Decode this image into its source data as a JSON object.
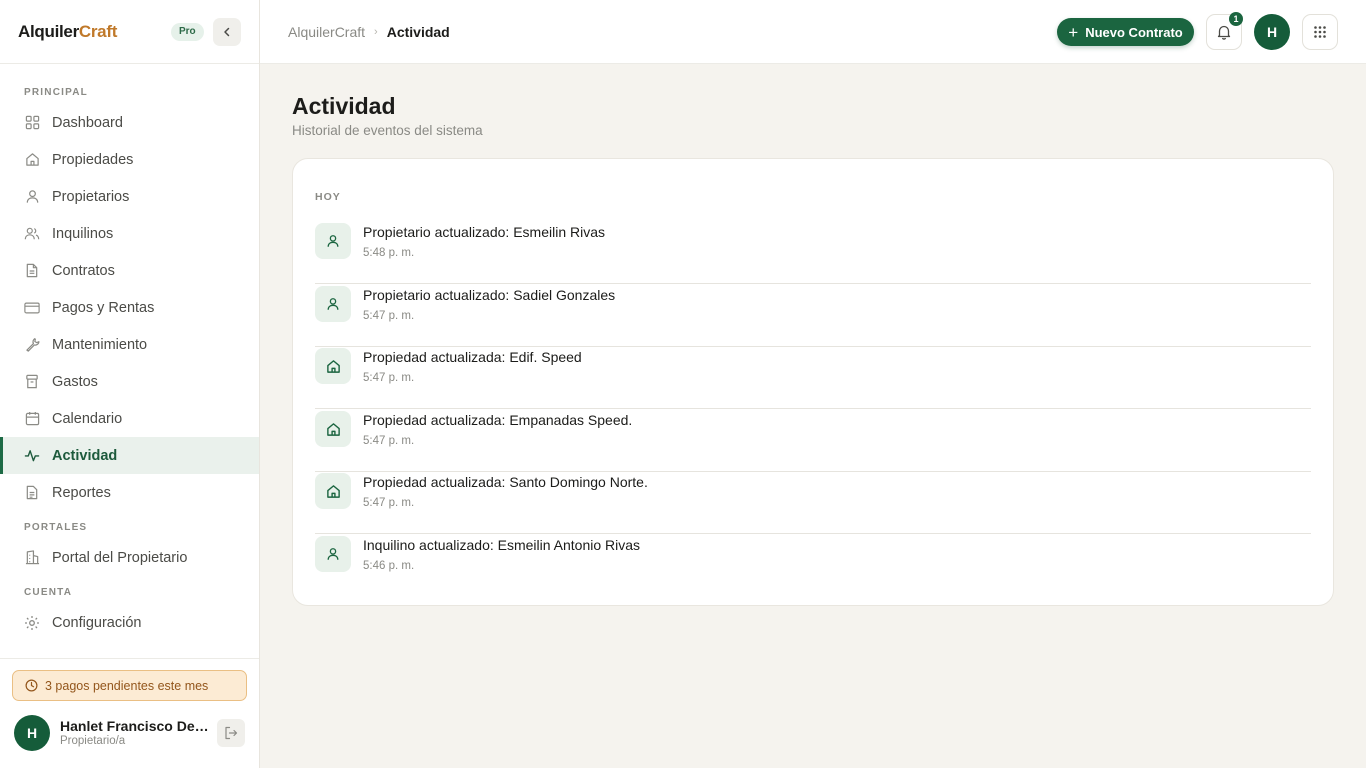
{
  "brand": {
    "part1": "Alquiler",
    "part2": "Craft",
    "badge": "Pro"
  },
  "sidebar": {
    "section_principal": "PRINCIPAL",
    "section_portales": "PORTALES",
    "section_cuenta": "CUENTA",
    "items": [
      {
        "label": "Dashboard",
        "icon": "grid-icon"
      },
      {
        "label": "Propiedades",
        "icon": "house-icon"
      },
      {
        "label": "Propietarios",
        "icon": "user-icon"
      },
      {
        "label": "Inquilinos",
        "icon": "users-icon"
      },
      {
        "label": "Contratos",
        "icon": "document-icon"
      },
      {
        "label": "Pagos y Rentas",
        "icon": "credit-card-icon"
      },
      {
        "label": "Mantenimiento",
        "icon": "wrench-icon"
      },
      {
        "label": "Gastos",
        "icon": "archive-icon"
      },
      {
        "label": "Calendario",
        "icon": "calendar-icon"
      },
      {
        "label": "Actividad",
        "icon": "activity-icon",
        "active": true
      },
      {
        "label": "Reportes",
        "icon": "report-icon"
      },
      {
        "label": "Portal del Propietario",
        "icon": "building-icon"
      },
      {
        "label": "Configuración",
        "icon": "gear-icon"
      }
    ],
    "pending": "3 pagos pendientes este mes",
    "user": {
      "initial": "H",
      "name": "Hanlet Francisco De L...",
      "role": "Propietario/a"
    }
  },
  "header": {
    "breadcrumb_root": "AlquilerCraft",
    "breadcrumb_sep": "›",
    "breadcrumb_current": "Actividad",
    "new_contract": "Nuevo Contrato",
    "notification_count": "1",
    "avatar_initial": "H"
  },
  "main": {
    "title": "Actividad",
    "subtitle": "Historial de eventos del sistema",
    "group": "HOY",
    "events": [
      {
        "title": "Propietario actualizado: Esmeilin Rivas",
        "time": "5:48 p. m.",
        "icon": "user-icon"
      },
      {
        "title": "Propietario actualizado: Sadiel Gonzales",
        "time": "5:47 p. m.",
        "icon": "user-icon"
      },
      {
        "title": "Propiedad actualizada: Edif. Speed",
        "time": "5:47 p. m.",
        "icon": "house-icon"
      },
      {
        "title": "Propiedad actualizada: Empanadas Speed.",
        "time": "5:47 p. m.",
        "icon": "house-icon"
      },
      {
        "title": "Propiedad actualizada: Santo Domingo Norte.",
        "time": "5:47 p. m.",
        "icon": "house-icon"
      },
      {
        "title": "Inquilino actualizado: Esmeilin Antonio Rivas",
        "time": "5:46 p. m.",
        "icon": "user-icon"
      }
    ]
  },
  "colors": {
    "accent": "#1b6540",
    "brand_secondary": "#c0792a",
    "background": "#f5f3ee",
    "pending_bg": "#fcebd4"
  }
}
